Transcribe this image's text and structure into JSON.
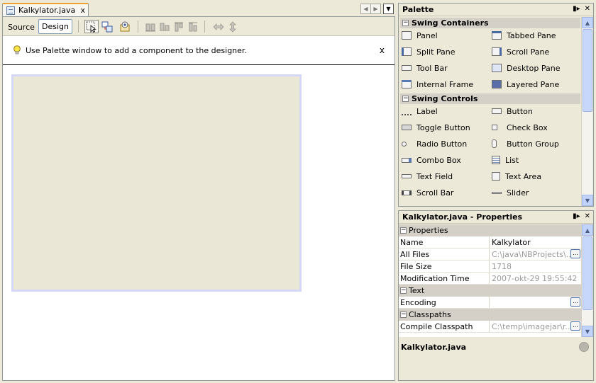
{
  "editor": {
    "tab_label": "Kalkylator.java",
    "tab_close": "x",
    "nav_left": "◀",
    "nav_right": "▶",
    "tab_menu": "▼",
    "source_label": "Source",
    "design_label": "Design",
    "hint_text": "Use Palette window to add a component to the designer.",
    "hint_close": "x"
  },
  "palette": {
    "title": "Palette",
    "ctrl_min": "▮▸",
    "ctrl_close": "✕",
    "categories": [
      {
        "label": "Swing Containers",
        "toggle": "−",
        "items": [
          "Panel",
          "Tabbed Pane",
          "Split Pane",
          "Scroll Pane",
          "Tool Bar",
          "Desktop Pane",
          "Internal Frame",
          "Layered Pane"
        ]
      },
      {
        "label": "Swing Controls",
        "toggle": "−",
        "items": [
          "Label",
          "Button",
          "Toggle Button",
          "Check Box",
          "Radio Button",
          "Button Group",
          "Combo Box",
          "List",
          "Text Field",
          "Text Area",
          "Scroll Bar",
          "Slider"
        ]
      }
    ]
  },
  "properties": {
    "title": "Kalkylator.java - Properties",
    "ctrl_min": "▮▸",
    "ctrl_close": "✕",
    "groups": [
      {
        "label": "Properties",
        "toggle": "−",
        "rows": [
          {
            "name": "Name",
            "value": "Kalkylator",
            "readonly": false,
            "button": false
          },
          {
            "name": "All Files",
            "value": "C:\\java\\NBProjects\\...",
            "readonly": true,
            "button": true
          },
          {
            "name": "File Size",
            "value": "1718",
            "readonly": true,
            "button": false
          },
          {
            "name": "Modification Time",
            "value": "2007-okt-29 19:55:42",
            "readonly": true,
            "button": false
          }
        ]
      },
      {
        "label": "Text",
        "toggle": "−",
        "rows": [
          {
            "name": "Encoding",
            "value": "",
            "readonly": false,
            "button": true
          }
        ]
      },
      {
        "label": "Classpaths",
        "toggle": "−",
        "rows": [
          {
            "name": "Compile Classpath",
            "value": "C:\\temp\\imagejar\\r...",
            "readonly": true,
            "button": true
          }
        ]
      }
    ],
    "ellipsis": "...",
    "status": "Kalkylator.java"
  },
  "colors": {
    "window_bg": "#ece9d8",
    "tab_highlight": "#f0a030",
    "canvas_bg": "#ebe7d6",
    "canvas_border": "#d5d8f7",
    "scroll_blue": "#c1d3fb"
  }
}
